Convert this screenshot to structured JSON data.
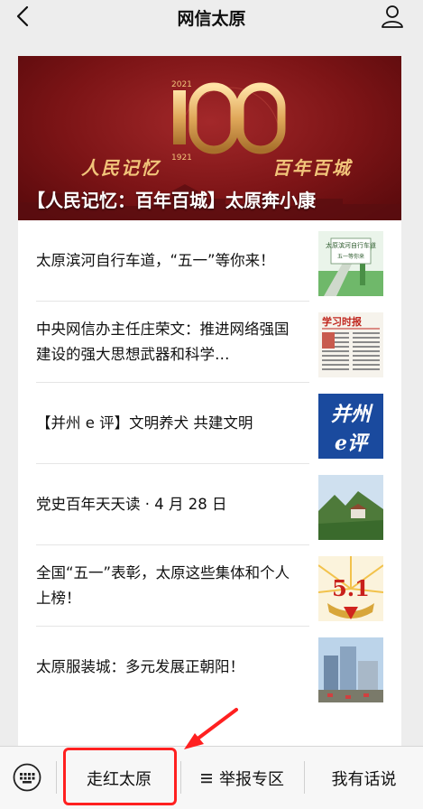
{
  "header": {
    "title": "网信太原",
    "back_icon": "chevron-left-icon",
    "profile_icon": "person-icon"
  },
  "banner": {
    "title": "【人民记忆：百年百城】太原奔小康",
    "logo_number": "100",
    "logo_year_top": "2021",
    "logo_year_bottom": "1921",
    "logo_side_text": "人民记忆",
    "slogan_left": "人民记忆",
    "slogan_right": "百年百城",
    "sub_text": "太原奔小康"
  },
  "articles": [
    {
      "title": "太原滨河自行车道，“五一”等你来！",
      "thumb_text": "太原滨河自行车道",
      "thumb_sub": "五一等你来"
    },
    {
      "title": "中央网信办主任庄荣文：推进网络强国建设的强大思想武器和科学…",
      "thumb_text": "学习时报"
    },
    {
      "title": "【并州 e 评】文明养犬 共建文明",
      "thumb_text_1": "并州",
      "thumb_text_2": "e评"
    },
    {
      "title": "党史百年天天读 · 4 月 28 日"
    },
    {
      "title": "全国“五一”表彰，太原这些集体和个人上榜！",
      "thumb_text": "5.1"
    },
    {
      "title": "太原服装城：多元发展正朝阳！"
    }
  ],
  "bottom_menu": {
    "keyboard_icon": "keyboard-icon",
    "item1": "走红太原",
    "item2": "举报专区",
    "item2_icon": "menu-lines-icon",
    "item3": "我有话说"
  },
  "colors": {
    "banner_red": "#7c1416",
    "gold": "#f1c47a",
    "highlight": "#ff2020"
  }
}
